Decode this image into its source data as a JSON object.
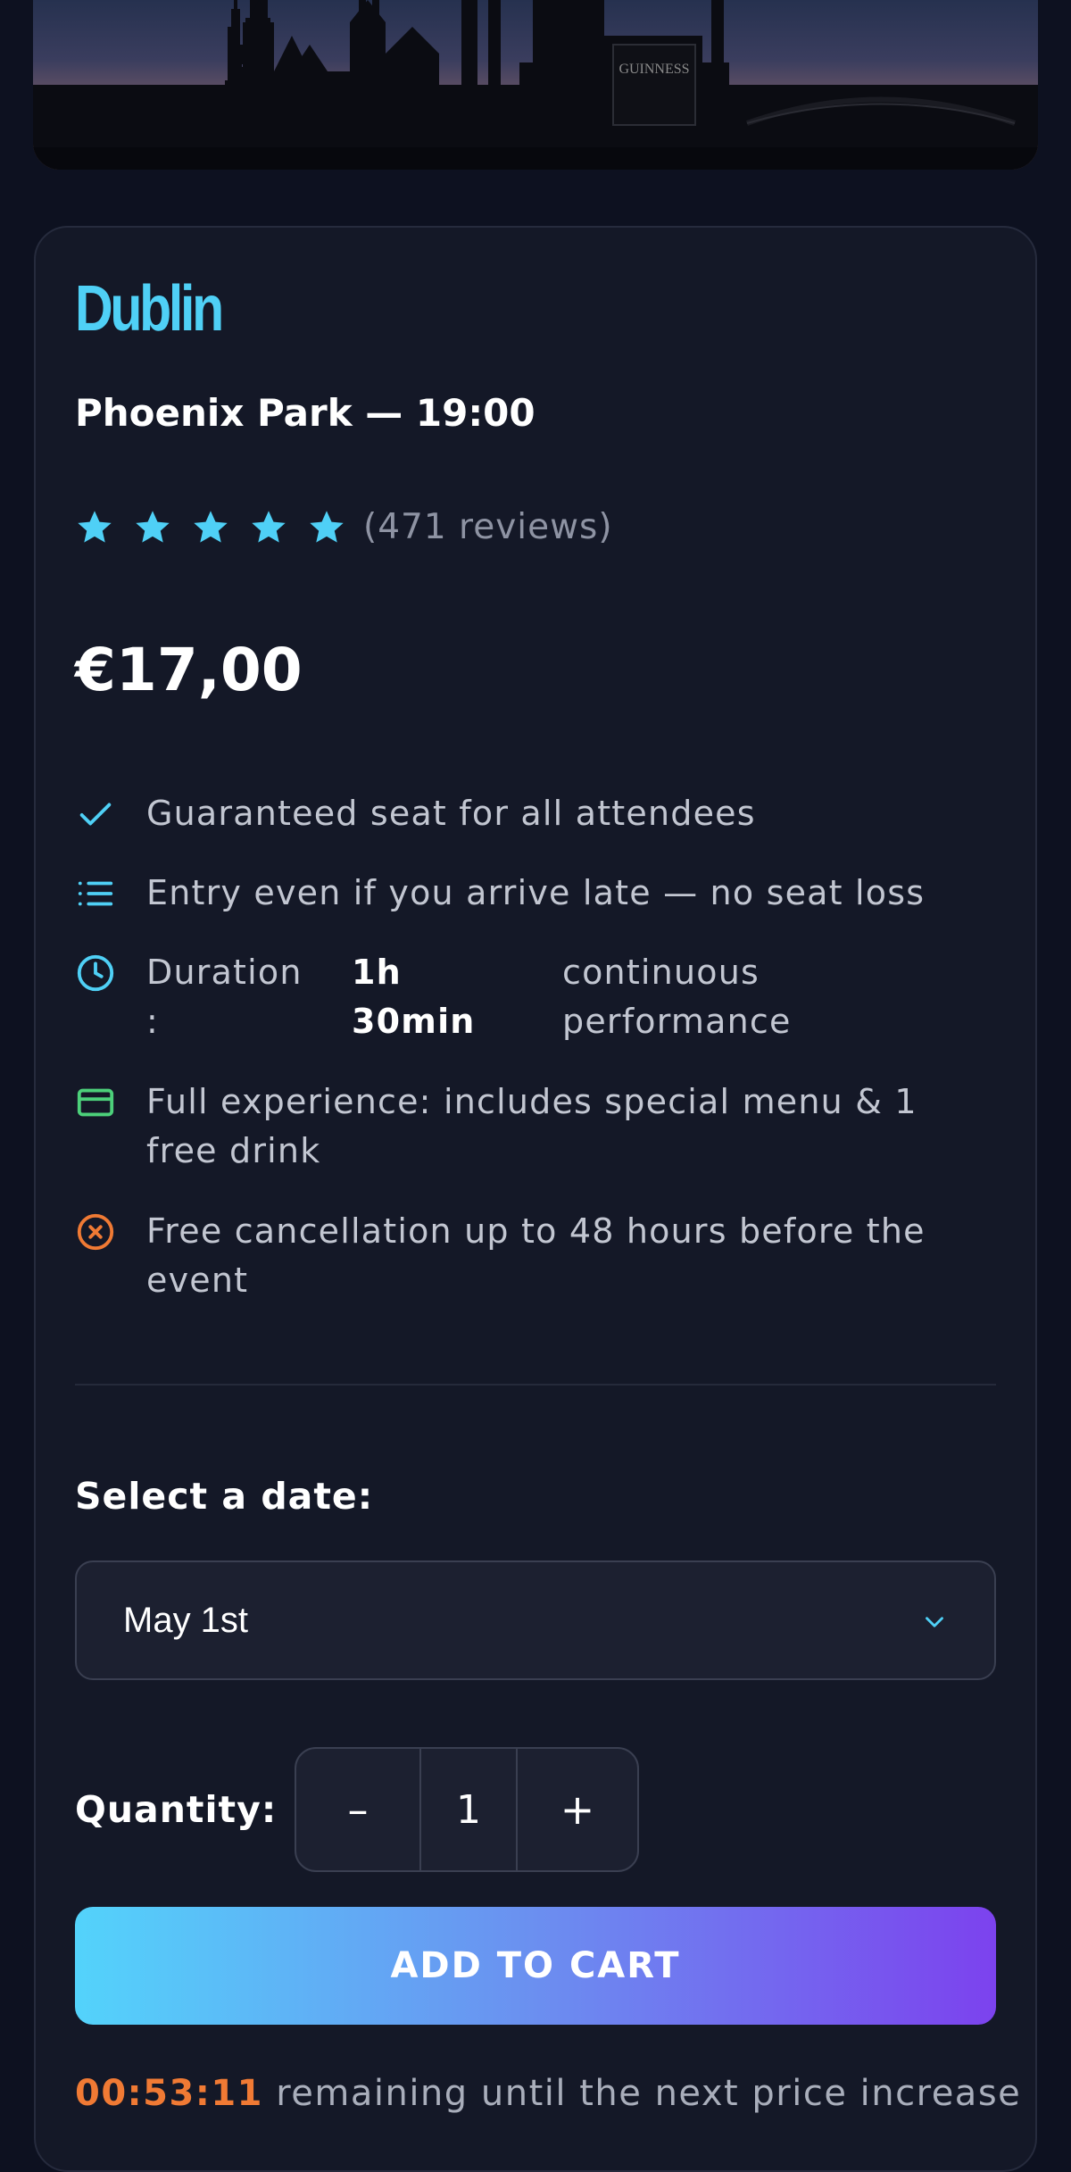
{
  "hero": {
    "sign_text": "GUINNESS"
  },
  "event": {
    "city": "Dublin",
    "venue": "Phoenix Park — 19:00",
    "rating": {
      "stars": 5,
      "reviews_text": "(471 reviews)"
    },
    "price": "€17,00"
  },
  "features": [
    {
      "icon": "check-icon",
      "text": "Guaranteed seat for all attendees"
    },
    {
      "icon": "list-icon",
      "text": "Entry even if you arrive late — no seat loss"
    },
    {
      "icon": "clock-icon",
      "label": "Duration",
      "label_colon": ":",
      "value_1": "1h",
      "value_2": "30min",
      "note_1": "continuous",
      "note_2": "performance"
    },
    {
      "icon": "credit-card-icon",
      "line_1": "Full experience: includes special menu & 1",
      "line_2": "free drink"
    },
    {
      "icon": "x-circle-icon",
      "line_1": "Free cancellation up to 48 hours before the",
      "line_2": "event"
    }
  ],
  "date_select": {
    "label": "Select a date:",
    "value": "May 1st"
  },
  "quantity": {
    "label": "Quantity:",
    "minus": "–",
    "value": "1",
    "plus": "+"
  },
  "cart_button": "ADD TO CART",
  "timer": {
    "countdown": "00:53:11",
    "message": " remaining until the next price increase"
  },
  "colors": {
    "accent": "#4fd0f6",
    "background": "#0d1120",
    "card": "#141827",
    "timer": "#f07a34",
    "card_icon": "#4cd07a"
  }
}
